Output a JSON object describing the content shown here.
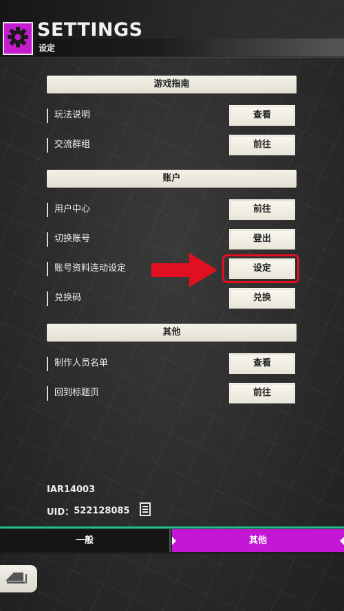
{
  "header": {
    "title": "SETTINGS",
    "subtitle": "设定",
    "icon": "gear-icon",
    "accent_color": "#c51ccf"
  },
  "sections": {
    "guide": {
      "title": "游戏指南",
      "rows": [
        {
          "label": "玩法说明",
          "button": "查看"
        },
        {
          "label": "交流群组",
          "button": "前往"
        }
      ]
    },
    "account": {
      "title": "账户",
      "rows": [
        {
          "label": "用户中心",
          "button": "前往"
        },
        {
          "label": "切换账号",
          "button": "登出"
        },
        {
          "label": "账号资料连动设定",
          "button": "设定"
        },
        {
          "label": "兑换码",
          "button": "兑换"
        }
      ]
    },
    "other": {
      "title": "其他",
      "rows": [
        {
          "label": "制作人员名单",
          "button": "查看"
        },
        {
          "label": "回到标题页",
          "button": "前往"
        }
      ]
    }
  },
  "annotation": {
    "arrow_color": "#e01020",
    "highlight_target": "account-link-settings-button"
  },
  "footer": {
    "version": "IAR14003",
    "uid_label": "UID：",
    "uid_value": "522128085",
    "copy_icon": "copy-icon"
  },
  "tabs": [
    {
      "label": "一般",
      "active": false
    },
    {
      "label": "其他",
      "active": true
    }
  ],
  "back_button": {
    "icon": "back-arrow-icon"
  }
}
